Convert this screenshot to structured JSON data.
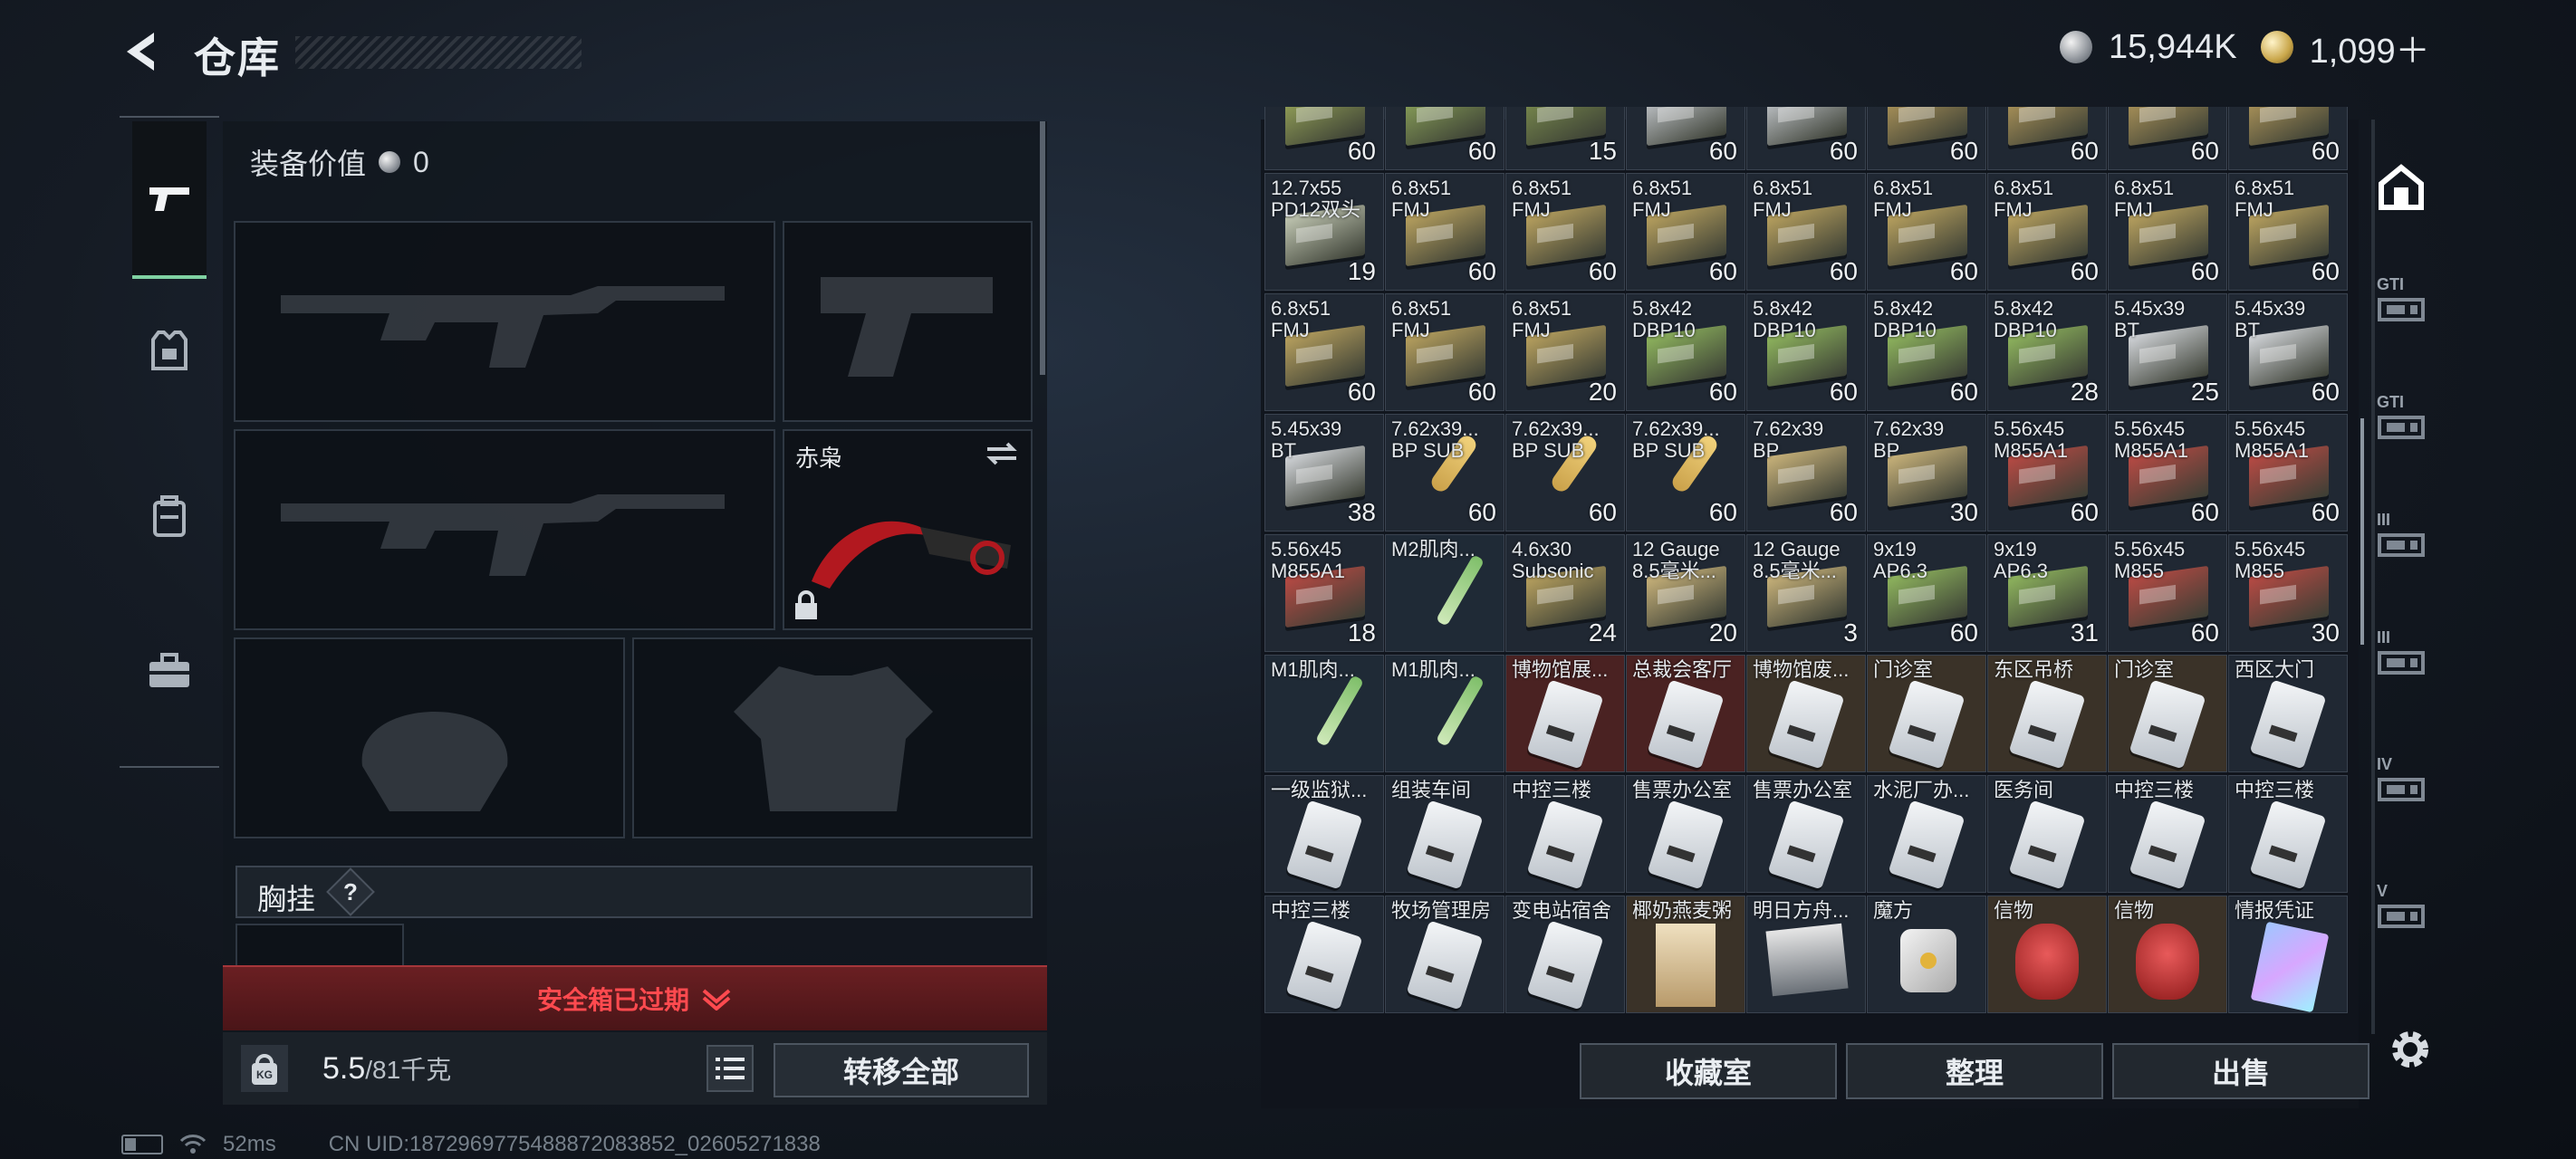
{
  "header": {
    "title": "仓库"
  },
  "currency": {
    "silver": "15,944K",
    "gold": "1,099＋"
  },
  "equipment": {
    "value_label": "装备价值",
    "value": "0",
    "melee_name": "赤枭",
    "chest_label": "胸挂",
    "chest_help": "?"
  },
  "safe_box": {
    "text": "安全箱已过期"
  },
  "weight": {
    "current": "5.5",
    "max_unit": "/81千克",
    "icon_label": "KG"
  },
  "buttons": {
    "transfer_all": "转移全部",
    "collection": "收藏室",
    "sort": "整理",
    "sell": "出售"
  },
  "status": {
    "ping": "52ms",
    "uid": "CN UID:1872969775488872083852_02605271838"
  },
  "colors": {
    "accent_green": "#7fd1a2",
    "alert_red": "#ff4a4f",
    "safe_bg": "#5a1a1d"
  },
  "warehouse_rows": [
    [
      {
        "name": "",
        "count": "60",
        "kind": "box",
        "color": "#9aa85a"
      },
      {
        "name": "",
        "count": "60",
        "kind": "box",
        "color": "#8ea65b"
      },
      {
        "name": "",
        "count": "15",
        "kind": "box",
        "color": "#7d8f4f"
      },
      {
        "name": "",
        "count": "60",
        "kind": "box",
        "color": "#c9cdd2"
      },
      {
        "name": "",
        "count": "60",
        "kind": "box",
        "color": "#c9cdd2"
      },
      {
        "name": "",
        "count": "60",
        "kind": "box",
        "color": "#b49a5c"
      },
      {
        "name": "",
        "count": "60",
        "kind": "box",
        "color": "#b49a5c"
      },
      {
        "name": "",
        "count": "60",
        "kind": "box",
        "color": "#b49a5c"
      },
      {
        "name": "",
        "count": "60",
        "kind": "box",
        "color": "#b49a5c"
      }
    ],
    [
      {
        "name": "12.7x55\nPD12双头",
        "count": "19",
        "kind": "box",
        "color": "#c3c9b4"
      },
      {
        "name": "6.8x51\nFMJ",
        "count": "60",
        "kind": "box",
        "color": "#b8a15f"
      },
      {
        "name": "6.8x51\nFMJ",
        "count": "60",
        "kind": "box",
        "color": "#b8a15f"
      },
      {
        "name": "6.8x51\nFMJ",
        "count": "60",
        "kind": "box",
        "color": "#b8a15f"
      },
      {
        "name": "6.8x51\nFMJ",
        "count": "60",
        "kind": "box",
        "color": "#b8a15f"
      },
      {
        "name": "6.8x51\nFMJ",
        "count": "60",
        "kind": "box",
        "color": "#b8a15f"
      },
      {
        "name": "6.8x51\nFMJ",
        "count": "60",
        "kind": "box",
        "color": "#b8a15f"
      },
      {
        "name": "6.8x51\nFMJ",
        "count": "60",
        "kind": "box",
        "color": "#b8a15f"
      },
      {
        "name": "6.8x51\nFMJ",
        "count": "60",
        "kind": "box",
        "color": "#b8a15f"
      }
    ],
    [
      {
        "name": "6.8x51\nFMJ",
        "count": "60",
        "kind": "box",
        "color": "#b8a15f"
      },
      {
        "name": "6.8x51\nFMJ",
        "count": "60",
        "kind": "box",
        "color": "#b8a15f"
      },
      {
        "name": "6.8x51\nFMJ",
        "count": "20",
        "kind": "box",
        "color": "#b8a15f"
      },
      {
        "name": "5.8x42\nDBP10",
        "count": "60",
        "kind": "box",
        "color": "#8fb55e"
      },
      {
        "name": "5.8x42\nDBP10",
        "count": "60",
        "kind": "box",
        "color": "#8fb55e"
      },
      {
        "name": "5.8x42\nDBP10",
        "count": "60",
        "kind": "box",
        "color": "#8fb55e"
      },
      {
        "name": "5.8x42\nDBP10",
        "count": "28",
        "kind": "box",
        "color": "#8fb55e"
      },
      {
        "name": "5.45x39\nBT",
        "count": "25",
        "kind": "box",
        "color": "#d2d5d9"
      },
      {
        "name": "5.45x39\nBT",
        "count": "60",
        "kind": "box",
        "color": "#d2d5d9"
      }
    ],
    [
      {
        "name": "5.45x39\nBT",
        "count": "38",
        "kind": "box",
        "color": "#d2d5d9"
      },
      {
        "name": "7.62x39...\nBP SUB",
        "count": "60",
        "kind": "bullet",
        "color": "#5c6b4c"
      },
      {
        "name": "7.62x39...\nBP SUB",
        "count": "60",
        "kind": "bullet",
        "color": "#5c6b4c"
      },
      {
        "name": "7.62x39...\nBP SUB",
        "count": "60",
        "kind": "bullet",
        "color": "#5c6b4c"
      },
      {
        "name": "7.62x39\nBP",
        "count": "60",
        "kind": "box",
        "color": "#c8b27a"
      },
      {
        "name": "7.62x39\nBP",
        "count": "30",
        "kind": "box",
        "color": "#c8b27a"
      },
      {
        "name": "5.56x45\nM855A1",
        "count": "60",
        "kind": "box",
        "color": "#b84a44"
      },
      {
        "name": "5.56x45\nM855A1",
        "count": "60",
        "kind": "box",
        "color": "#b84a44"
      },
      {
        "name": "5.56x45\nM855A1",
        "count": "60",
        "kind": "box",
        "color": "#b84a44"
      }
    ],
    [
      {
        "name": "5.56x45\nM855A1",
        "count": "18",
        "kind": "box",
        "color": "#b84a44"
      },
      {
        "name": "M2肌肉...",
        "count": "",
        "kind": "syringe",
        "color": ""
      },
      {
        "name": "4.6x30\nSubsonic",
        "count": "24",
        "kind": "box",
        "color": "#b8a15f"
      },
      {
        "name": "12 Gauge\n8.5毫米...",
        "count": "20",
        "kind": "box",
        "color": "#c8b27a"
      },
      {
        "name": "12 Gauge\n8.5毫米...",
        "count": "3",
        "kind": "box",
        "color": "#c8b27a"
      },
      {
        "name": "9x19\nAP6.3",
        "count": "60",
        "kind": "box",
        "color": "#8fb55e"
      },
      {
        "name": "9x19\nAP6.3",
        "count": "31",
        "kind": "box",
        "color": "#8fb55e"
      },
      {
        "name": "5.56x45\nM855",
        "count": "60",
        "kind": "box",
        "color": "#b84a44"
      },
      {
        "name": "5.56x45\nM855",
        "count": "30",
        "kind": "box",
        "color": "#b84a44"
      }
    ],
    [
      {
        "name": "M1肌肉...",
        "count": "",
        "kind": "syringe",
        "color": ""
      },
      {
        "name": "M1肌肉...",
        "count": "",
        "kind": "syringe",
        "color": ""
      },
      {
        "name": "博物馆展...",
        "count": "",
        "kind": "card",
        "color": "#4a2222"
      },
      {
        "name": "总裁会客厅",
        "count": "",
        "kind": "card",
        "color": "#4a2222"
      },
      {
        "name": "博物馆废...",
        "count": "",
        "kind": "card",
        "color": "#3a3228"
      },
      {
        "name": "门诊室",
        "count": "",
        "kind": "card",
        "color": "#3a3228"
      },
      {
        "name": "东区吊桥",
        "count": "",
        "kind": "card",
        "color": "#3a3228"
      },
      {
        "name": "门诊室",
        "count": "",
        "kind": "card",
        "color": "#3a3228"
      },
      {
        "name": "西区大门",
        "count": "",
        "kind": "card",
        "color": ""
      }
    ],
    [
      {
        "name": "一级监狱...",
        "count": "",
        "kind": "card",
        "color": ""
      },
      {
        "name": "组装车间",
        "count": "",
        "kind": "card",
        "color": ""
      },
      {
        "name": "中控三楼",
        "count": "",
        "kind": "card",
        "color": ""
      },
      {
        "name": "售票办公室",
        "count": "",
        "kind": "card",
        "color": ""
      },
      {
        "name": "售票办公室",
        "count": "",
        "kind": "card",
        "color": ""
      },
      {
        "name": "水泥厂办...",
        "count": "",
        "kind": "card",
        "color": ""
      },
      {
        "name": "医务间",
        "count": "",
        "kind": "card",
        "color": ""
      },
      {
        "name": "中控三楼",
        "count": "",
        "kind": "card",
        "color": ""
      },
      {
        "name": "中控三楼",
        "count": "",
        "kind": "card",
        "color": ""
      }
    ],
    [
      {
        "name": "中控三楼",
        "count": "",
        "kind": "card",
        "color": ""
      },
      {
        "name": "牧场管理房",
        "count": "",
        "kind": "card",
        "color": ""
      },
      {
        "name": "变电站宿舍",
        "count": "",
        "kind": "card",
        "color": ""
      },
      {
        "name": "椰奶燕麦粥",
        "count": "",
        "kind": "poster",
        "color": "#3a3228"
      },
      {
        "name": "明日方舟...",
        "count": "",
        "kind": "photo",
        "color": ""
      },
      {
        "name": "魔方",
        "count": "",
        "kind": "cube",
        "color": ""
      },
      {
        "name": "信物",
        "count": "",
        "kind": "skull",
        "color": "#3a3228"
      },
      {
        "name": "信物",
        "count": "",
        "kind": "skull",
        "color": "#3a3228"
      },
      {
        "name": "情报凭证",
        "count": "",
        "kind": "holo",
        "color": ""
      }
    ]
  ],
  "right_rail": {
    "items": [
      {
        "icon": "warehouse-icon",
        "label": ""
      },
      {
        "icon": "storage-1-icon",
        "label": "GTI"
      },
      {
        "icon": "storage-2-icon",
        "label": "GTI"
      },
      {
        "icon": "storage-3-icon",
        "label": "III"
      },
      {
        "icon": "storage-4-icon",
        "label": "III"
      },
      {
        "icon": "storage-5-icon",
        "label": "IV"
      },
      {
        "icon": "storage-6-icon",
        "label": "V"
      }
    ]
  }
}
